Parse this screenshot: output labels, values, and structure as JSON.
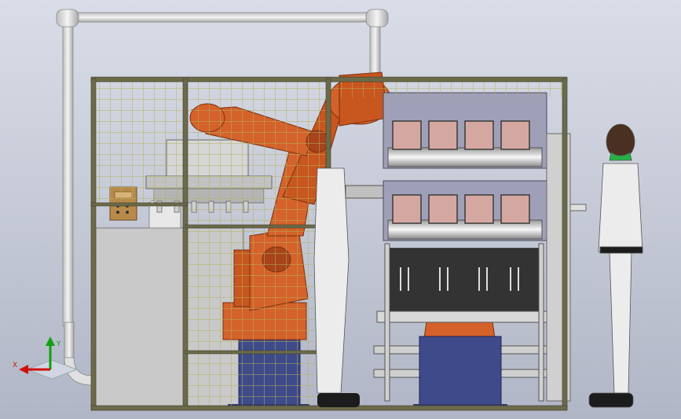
{
  "axes": {
    "x_label": "X",
    "y_label": "Y",
    "x_color": "#d01010",
    "y_color": "#10a010"
  },
  "palette": {
    "robot": "#d4622a",
    "robot_dark": "#a8431a",
    "frame": "#6b6a4a",
    "mesh": "#b3b25a",
    "pipe": "#e6e6e6",
    "base": "#3e4a8a",
    "cabinet": "#c9c9c9",
    "panel": "#b88a4a",
    "person_suit": "#ececec",
    "person_collar": "#26b046",
    "skin": "#4a3020"
  }
}
